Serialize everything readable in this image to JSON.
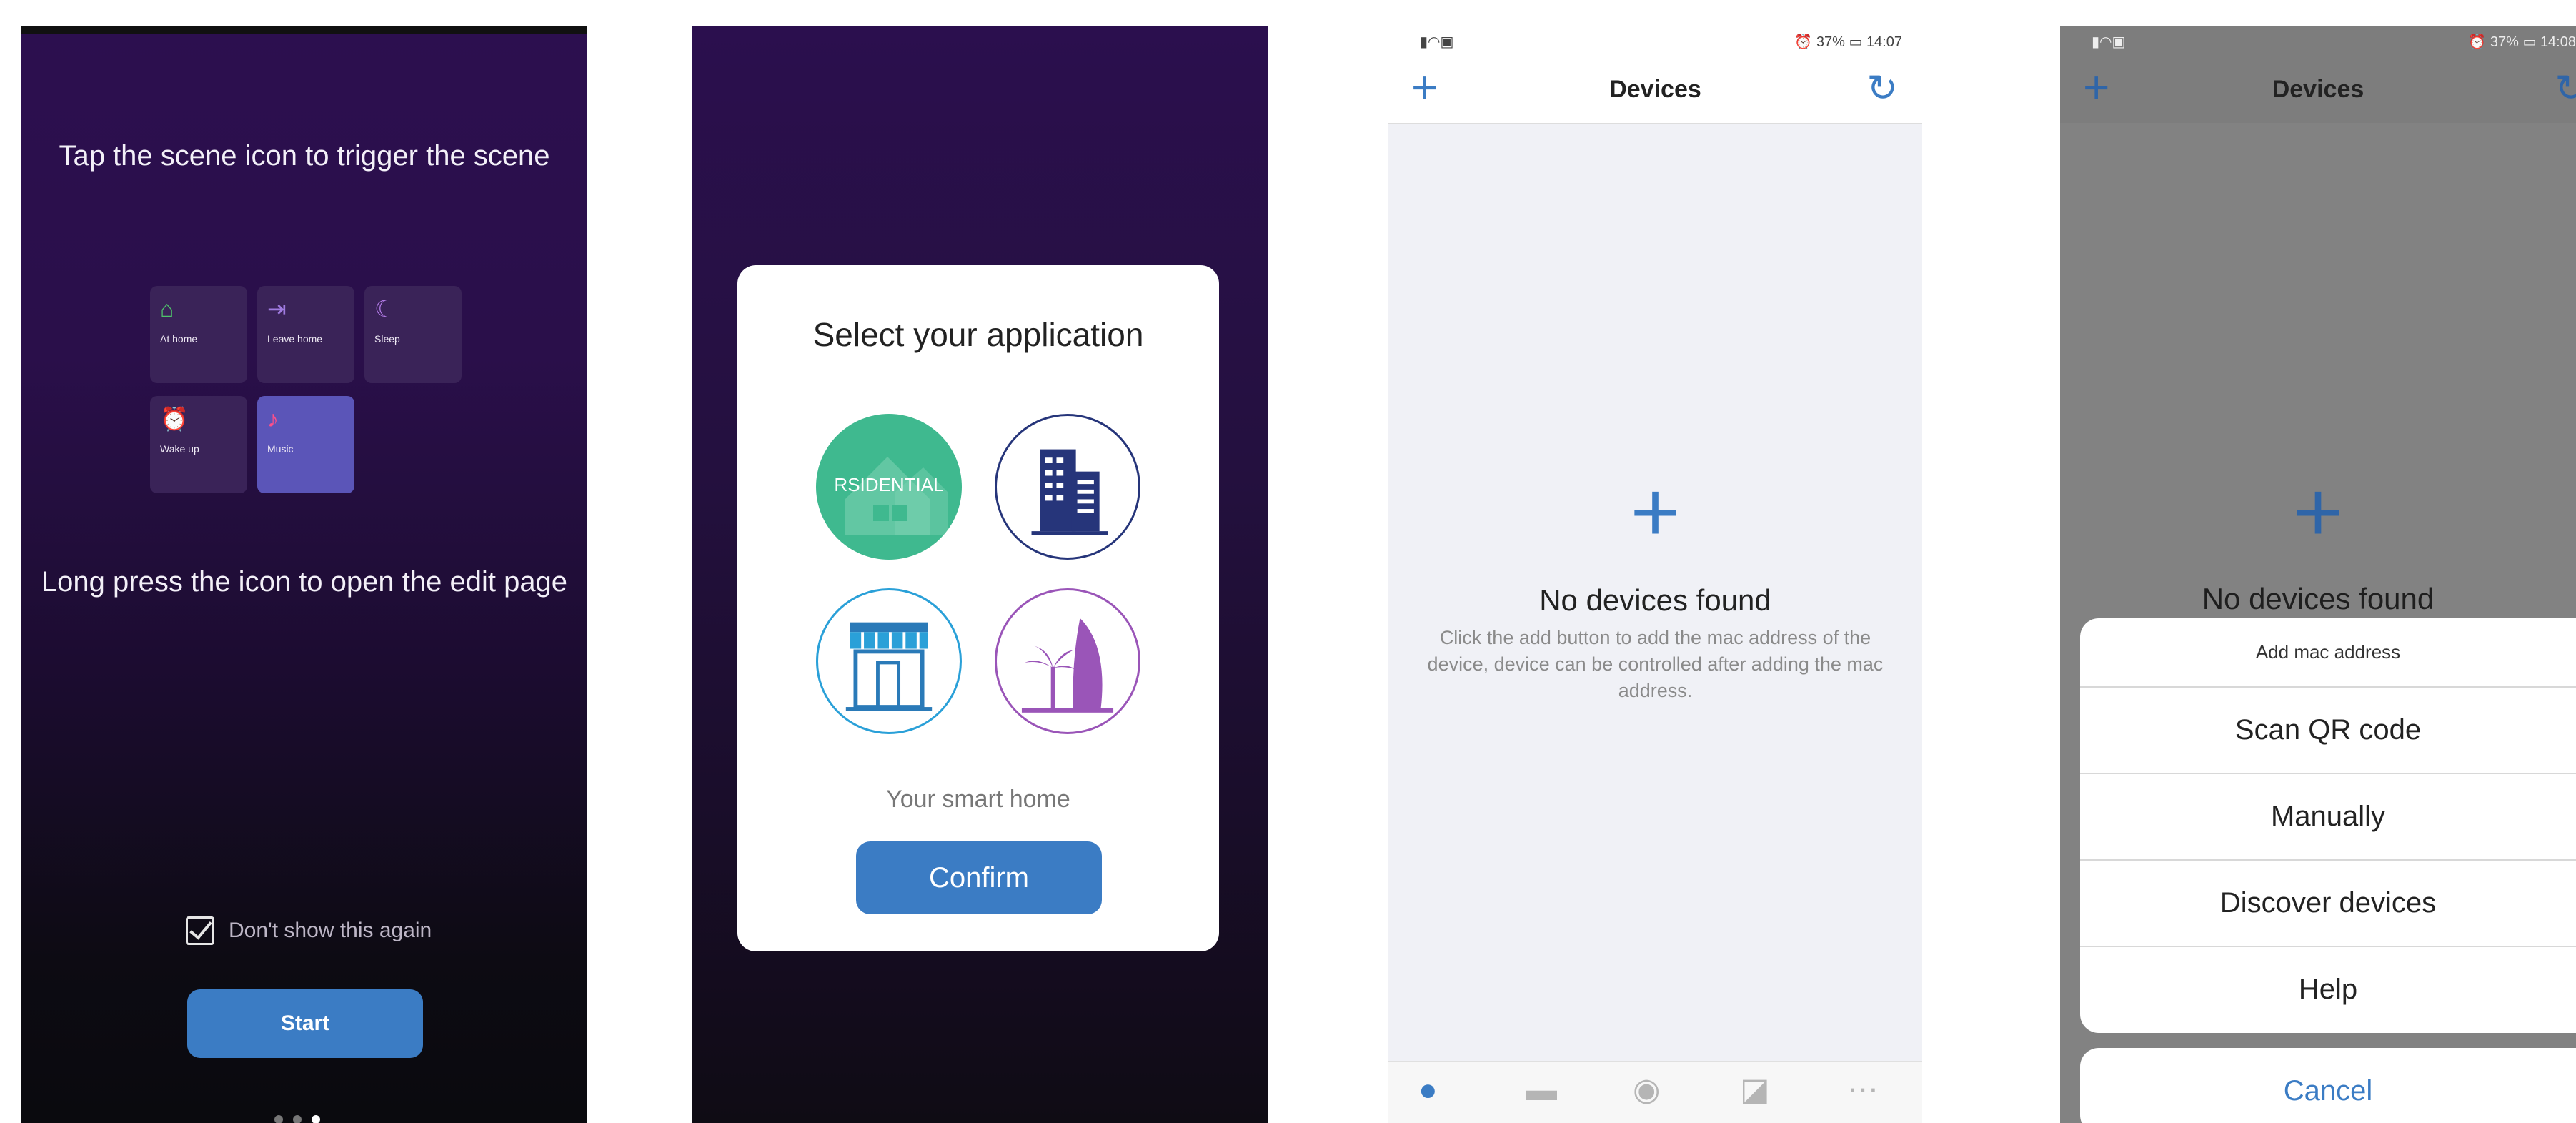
{
  "panel1": {
    "heading_top": "Tap the scene icon to trigger the scene",
    "scenes": [
      {
        "label": "At home",
        "icon": "home-icon",
        "color": "#4fc36b"
      },
      {
        "label": "Leave home",
        "icon": "exit-icon",
        "color": "#a07be0"
      },
      {
        "label": "Sleep",
        "icon": "moon-icon",
        "color": "#b27be6"
      },
      {
        "label": "Wake up",
        "icon": "alarm-icon",
        "color": "#f0a63a"
      },
      {
        "label": "Music",
        "icon": "music-note-icon",
        "color": "#ff4f8a",
        "active": true
      }
    ],
    "heading_bottom": "Long press the icon to open the edit page",
    "checkbox_label": "Don't show this again",
    "checkbox_checked": true,
    "start_label": "Start",
    "page_dots": {
      "count": 3,
      "active_index": 2
    }
  },
  "panel2": {
    "title": "Select your application",
    "options": [
      {
        "label": "RSIDENTIAL",
        "icon": "residential-icon",
        "color": "#3fb98f"
      },
      {
        "icon": "office-building-icon",
        "color": "#26357a"
      },
      {
        "icon": "storefront-icon",
        "color": "#2aa0d8"
      },
      {
        "icon": "hotel-palm-icon",
        "color": "#9a55b8"
      }
    ],
    "subtitle": "Your smart home",
    "confirm_label": "Confirm"
  },
  "panel3": {
    "status_time": "14:07",
    "status_battery": "37%",
    "nav_title": "Devices",
    "empty_title": "No devices found",
    "empty_description": "Click the add button to add the mac address of the device, device can be controlled after adding the mac address.",
    "tabs": [
      {
        "icon": "bulb-icon",
        "active": true
      },
      {
        "icon": "groups-icon"
      },
      {
        "icon": "play-icon"
      },
      {
        "icon": "chart-icon"
      },
      {
        "icon": "more-icon"
      }
    ]
  },
  "panel4": {
    "status_time": "14:08",
    "status_battery": "37%",
    "nav_title": "Devices",
    "empty_title": "No devices found",
    "sheet_title": "Add mac address",
    "sheet_items": [
      "Scan QR code",
      "Manually",
      "Discover devices",
      "Help"
    ],
    "cancel_label": "Cancel"
  }
}
